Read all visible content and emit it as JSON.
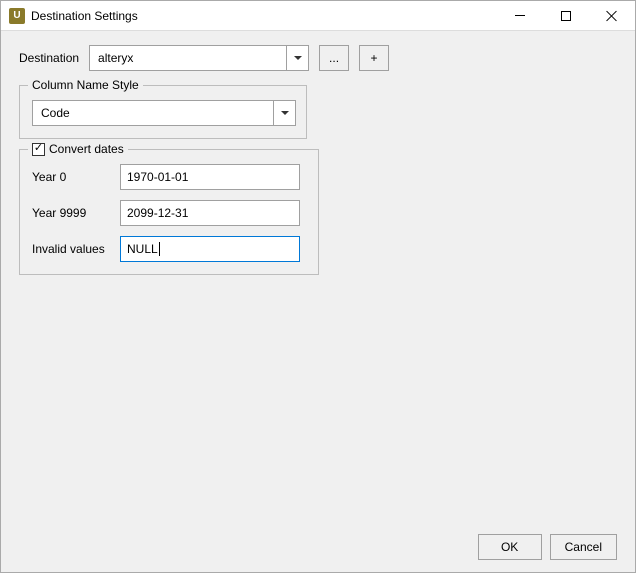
{
  "window": {
    "title": "Destination Settings",
    "icon_letter": "U"
  },
  "destination": {
    "label": "Destination",
    "selected": "alteryx",
    "browse_label": "...",
    "add_label": "+"
  },
  "column_name_style": {
    "legend": "Column Name Style",
    "selected": "Code"
  },
  "convert_dates": {
    "legend": "Convert dates",
    "checked": true,
    "year0_label": "Year 0",
    "year0_value": "1970-01-01",
    "year9999_label": "Year 9999",
    "year9999_value": "2099-12-31",
    "invalid_label": "Invalid values",
    "invalid_value": "NULL"
  },
  "buttons": {
    "ok": "OK",
    "cancel": "Cancel"
  }
}
